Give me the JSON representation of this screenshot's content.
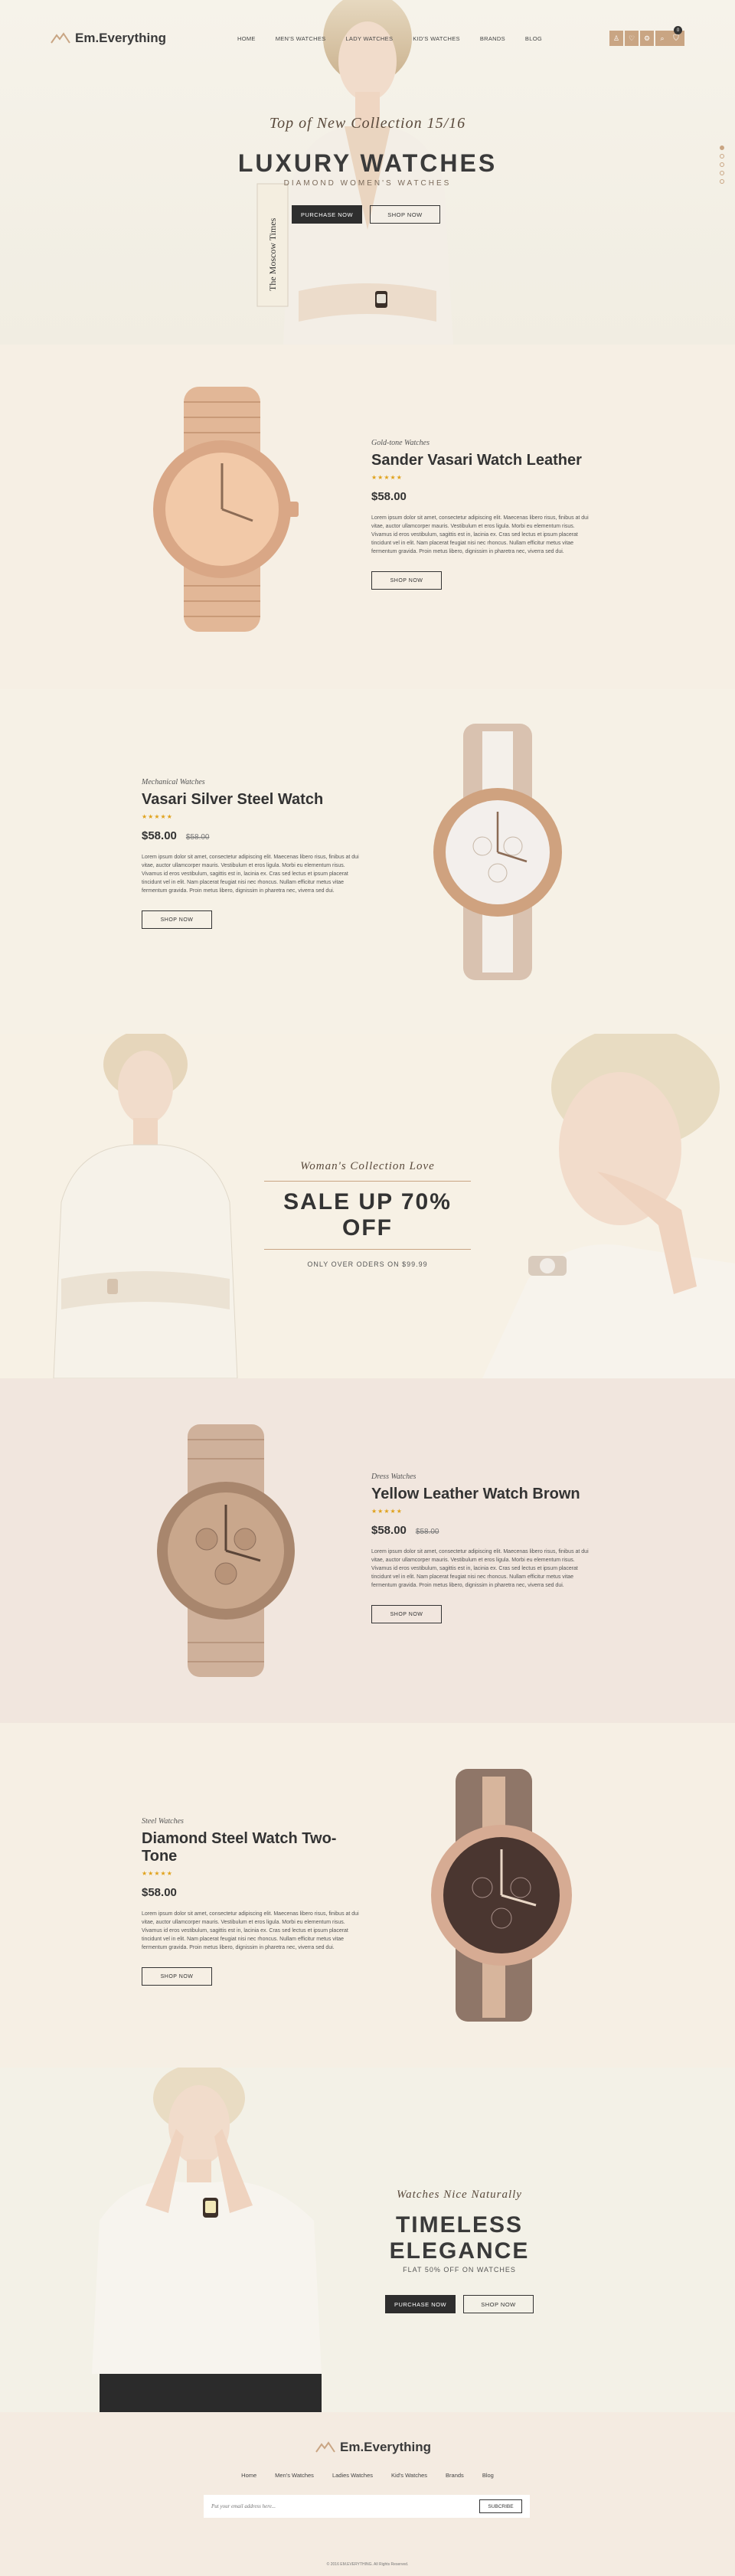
{
  "header": {
    "logo": "Em.Everything",
    "nav": [
      "HOME",
      "MEN'S WATCHES",
      "LADY WATCHES",
      "KID'S WATCHES",
      "BRANDS",
      "BLOG"
    ],
    "cart_count": "0"
  },
  "hero": {
    "kicker": "Top of New Collection 15/16",
    "title": "LUXURY WATCHES",
    "subtitle": "DIAMOND WOMEN'S WATCHES",
    "btn_primary": "PURCHASE NOW",
    "btn_secondary": "SHOP NOW",
    "book_text": "The Moscow Times"
  },
  "products": [
    {
      "category": "Gold-tone Watches",
      "name": "Sander Vasari Watch Leather",
      "stars": "★★★★★",
      "price": "$58.00",
      "old_price": "",
      "description": "Lorem ipsum dolor sit amet, consectetur adipiscing elit. Maecenas libero risus, finibus at dui vitae, auctor ullamcorper mauris. Vestibulum et eros ligula. Morbi eu elementum risus. Vivamus id eros vestibulum, sagittis est in, lacinia ex. Cras sed lectus et ipsum placerat tincidunt vel in elit. Nam placerat feugiat nisi nec rhoncus. Nullam efficitur metus vitae fermentum gravida. Proin metus libero, dignissim in pharetra nec, viverra sed dui.",
      "button": "SHOP NOW"
    },
    {
      "category": "Mechanical Watches",
      "name": "Vasari Silver Steel Watch",
      "stars": "★★★★★",
      "price": "$58.00",
      "old_price": "$58.00",
      "description": "Lorem ipsum dolor sit amet, consectetur adipiscing elit. Maecenas libero risus, finibus at dui vitae, auctor ullamcorper mauris. Vestibulum et eros ligula. Morbi eu elementum risus. Vivamus id eros vestibulum, sagittis est in, lacinia ex. Cras sed lectus et ipsum placerat tincidunt vel in elit. Nam placerat feugiat nisi nec rhoncus. Nullam efficitur metus vitae fermentum gravida. Proin metus libero, dignissim in pharetra nec, viverra sed dui.",
      "button": "SHOP NOW"
    },
    {
      "category": "Dress Watches",
      "name": "Yellow Leather Watch Brown",
      "stars": "★★★★★",
      "price": "$58.00",
      "old_price": "$58.00",
      "description": "Lorem ipsum dolor sit amet, consectetur adipiscing elit. Maecenas libero risus, finibus at dui vitae, auctor ullamcorper mauris. Vestibulum et eros ligula. Morbi eu elementum risus. Vivamus id eros vestibulum, sagittis est in, lacinia ex. Cras sed lectus et ipsum placerat tincidunt vel in elit. Nam placerat feugiat nisi nec rhoncus. Nullam efficitur metus vitae fermentum gravida. Proin metus libero, dignissim in pharetra nec, viverra sed dui.",
      "button": "SHOP NOW"
    },
    {
      "category": "Steel Watches",
      "name": "Diamond Steel Watch Two-Tone",
      "stars": "★★★★★",
      "price": "$58.00",
      "old_price": "",
      "description": "Lorem ipsum dolor sit amet, consectetur adipiscing elit. Maecenas libero risus, finibus at dui vitae, auctor ullamcorper mauris. Vestibulum et eros ligula. Morbi eu elementum risus. Vivamus id eros vestibulum, sagittis est in, lacinia ex. Cras sed lectus et ipsum placerat tincidunt vel in elit. Nam placerat feugiat nisi nec rhoncus. Nullam efficitur metus vitae fermentum gravida. Proin metus libero, dignissim in pharetra nec, viverra sed dui.",
      "button": "SHOP NOW"
    }
  ],
  "sale": {
    "kicker": "Woman's Collection Love",
    "title": "SALE UP 70% OFF",
    "subtitle": "ONLY OVER ODERS ON $99.99"
  },
  "timeless": {
    "kicker": "Watches Nice Naturally",
    "title": "TIMELESS ELEGANCE",
    "subtitle": "FLAT 50% OFF ON WATCHES",
    "btn_primary": "PURCHASE NOW",
    "btn_secondary": "SHOP NOW"
  },
  "footer": {
    "logo": "Em.Everything",
    "nav": [
      "Home",
      "Men's Watches",
      "Ladies Watches",
      "Kid's Watches",
      "Brands",
      "Blog"
    ],
    "newsletter_placeholder": "Put your email address here...",
    "subscribe": "SUBCRIBE",
    "copyright": "© 2016 EM.EVERYTHING. All Rights Reserved."
  },
  "colors": {
    "accent": "#c9a583",
    "dark": "#2e2e2e",
    "page": "#f5f2ea",
    "stars": "#e0a21c"
  }
}
